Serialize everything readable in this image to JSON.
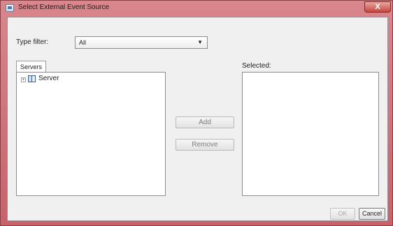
{
  "window": {
    "title": "Select External Event Source",
    "close_glyph": "X",
    "title_bar_color": "#c9616a"
  },
  "type_filter": {
    "label": "Type filter:",
    "value": "All"
  },
  "servers_tab": {
    "label": "Servers"
  },
  "tree": {
    "nodes": [
      {
        "label": "Server",
        "expander": "+",
        "icon": "server-icon"
      }
    ]
  },
  "selected": {
    "label": "Selected:"
  },
  "buttons": {
    "add": "Add",
    "remove": "Remove",
    "ok": "OK",
    "cancel": "Cancel"
  }
}
